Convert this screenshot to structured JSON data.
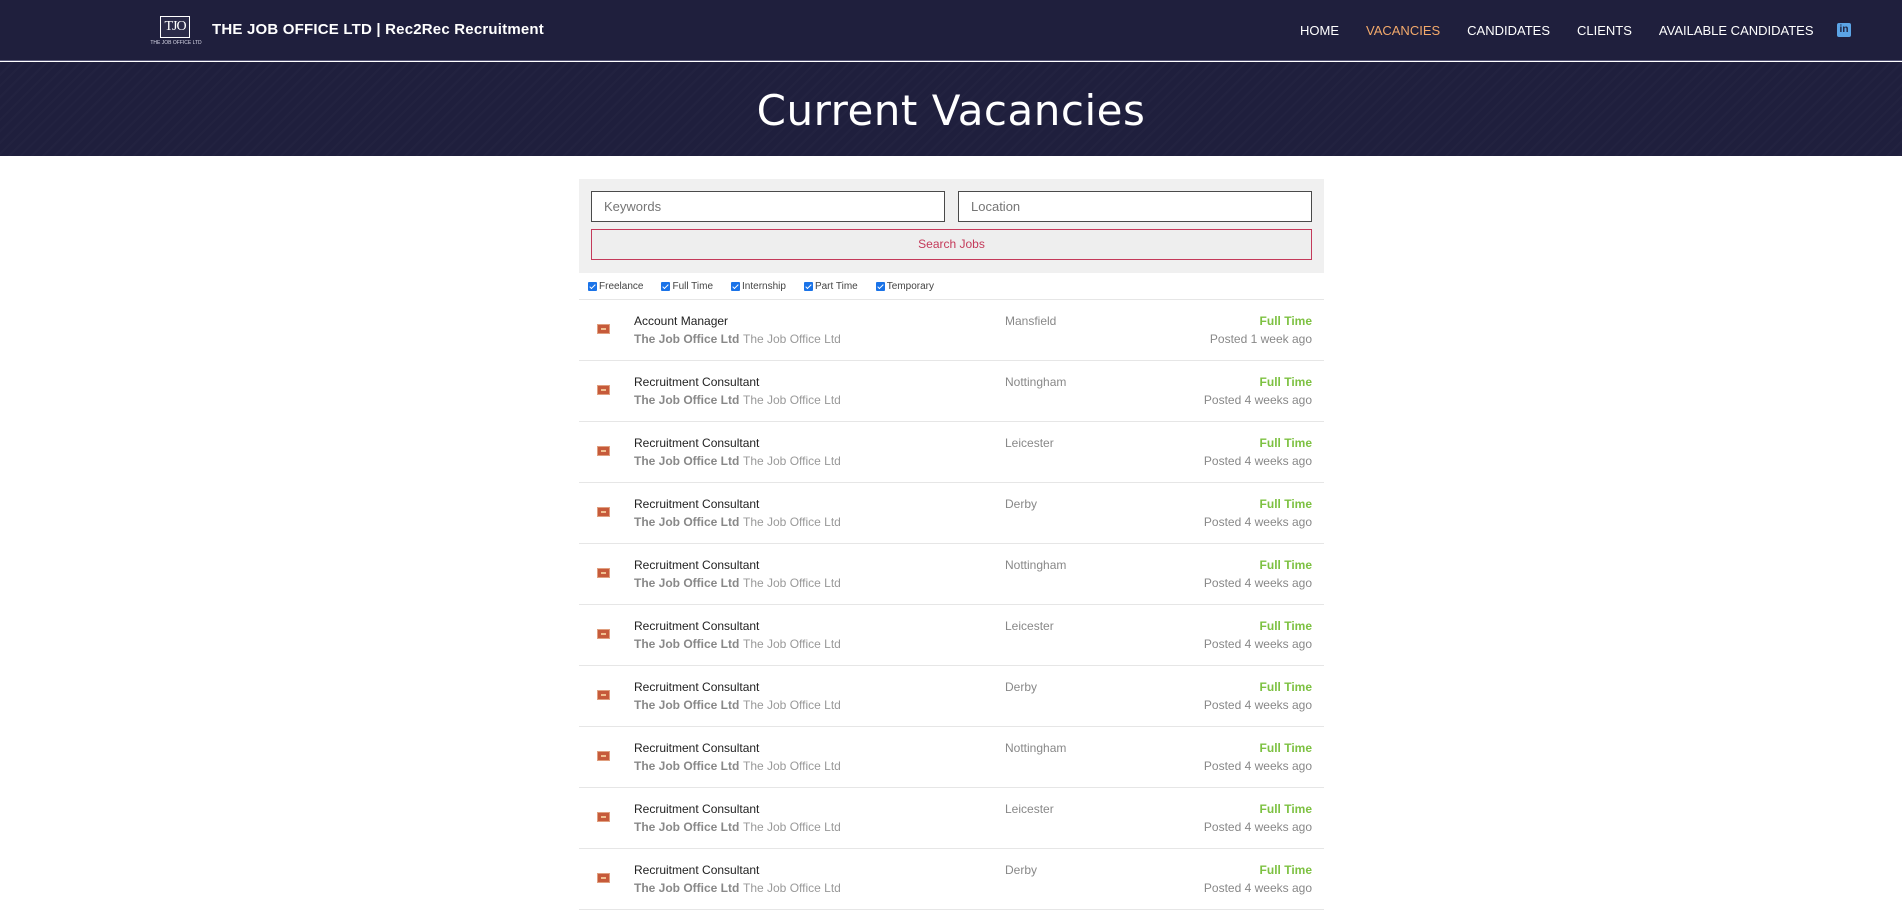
{
  "header": {
    "logo_text": "TJO",
    "logo_subtext": "THE JOB OFFICE LTD",
    "site_title": "THE JOB OFFICE LTD | Rec2Rec Recruitment",
    "nav": [
      {
        "label": "HOME"
      },
      {
        "label": "VACANCIES",
        "active": true
      },
      {
        "label": "CANDIDATES"
      },
      {
        "label": "CLIENTS"
      },
      {
        "label": "AVAILABLE CANDIDATES"
      }
    ],
    "social_icon": "linkedin-icon",
    "colors": {
      "background": "#1f1f3d",
      "active_nav": "#f2a96b"
    }
  },
  "hero": {
    "title": "Current Vacancies"
  },
  "search": {
    "keywords_placeholder": "Keywords",
    "location_placeholder": "Location",
    "button_label": "Search Jobs"
  },
  "filters": [
    {
      "label": "Freelance",
      "checked": true
    },
    {
      "label": "Full Time",
      "checked": true
    },
    {
      "label": "Internship",
      "checked": true
    },
    {
      "label": "Part Time",
      "checked": true
    },
    {
      "label": "Temporary",
      "checked": true
    }
  ],
  "jobs": [
    {
      "title": "Account Manager",
      "company": "The Job Office Ltd",
      "tagline": "The Job Office Ltd",
      "location": "Mansfield",
      "type": "Full Time",
      "posted": "Posted 1 week ago"
    },
    {
      "title": "Recruitment Consultant",
      "company": "The Job Office Ltd",
      "tagline": "The Job Office Ltd",
      "location": "Nottingham",
      "type": "Full Time",
      "posted": "Posted 4 weeks ago"
    },
    {
      "title": "Recruitment Consultant",
      "company": "The Job Office Ltd",
      "tagline": "The Job Office Ltd",
      "location": "Leicester",
      "type": "Full Time",
      "posted": "Posted 4 weeks ago"
    },
    {
      "title": "Recruitment Consultant",
      "company": "The Job Office Ltd",
      "tagline": "The Job Office Ltd",
      "location": "Derby",
      "type": "Full Time",
      "posted": "Posted 4 weeks ago"
    },
    {
      "title": "Recruitment Consultant",
      "company": "The Job Office Ltd",
      "tagline": "The Job Office Ltd",
      "location": "Nottingham",
      "type": "Full Time",
      "posted": "Posted 4 weeks ago"
    },
    {
      "title": "Recruitment Consultant",
      "company": "The Job Office Ltd",
      "tagline": "The Job Office Ltd",
      "location": "Leicester",
      "type": "Full Time",
      "posted": "Posted 4 weeks ago"
    },
    {
      "title": "Recruitment Consultant",
      "company": "The Job Office Ltd",
      "tagline": "The Job Office Ltd",
      "location": "Derby",
      "type": "Full Time",
      "posted": "Posted 4 weeks ago"
    },
    {
      "title": "Recruitment Consultant",
      "company": "The Job Office Ltd",
      "tagline": "The Job Office Ltd",
      "location": "Nottingham",
      "type": "Full Time",
      "posted": "Posted 4 weeks ago"
    },
    {
      "title": "Recruitment Consultant",
      "company": "The Job Office Ltd",
      "tagline": "The Job Office Ltd",
      "location": "Leicester",
      "type": "Full Time",
      "posted": "Posted 4 weeks ago"
    },
    {
      "title": "Recruitment Consultant",
      "company": "The Job Office Ltd",
      "tagline": "The Job Office Ltd",
      "location": "Derby",
      "type": "Full Time",
      "posted": "Posted 4 weeks ago"
    }
  ],
  "type_color": "#7dc142"
}
